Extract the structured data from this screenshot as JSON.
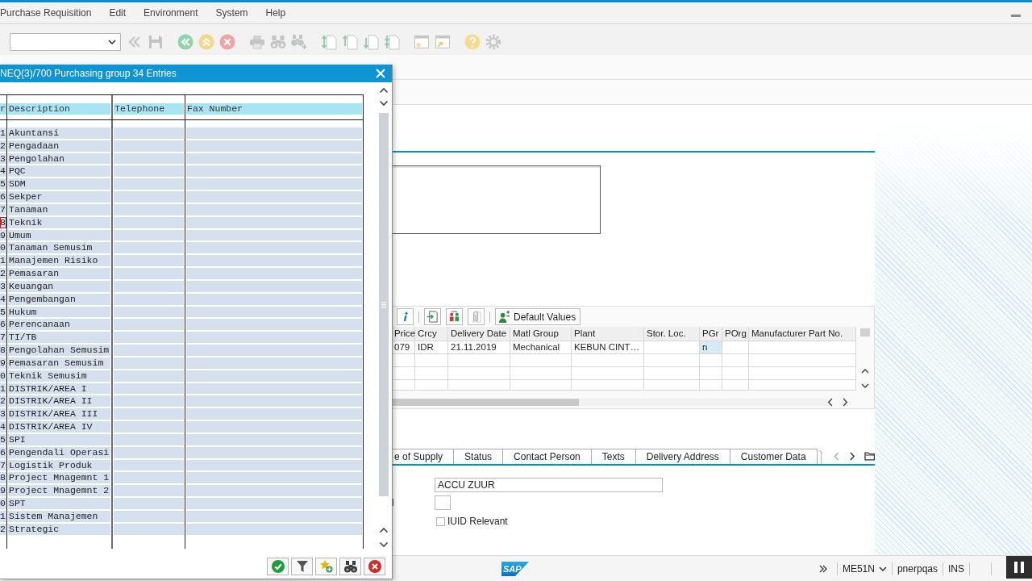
{
  "menu_bar": {
    "items": [
      {
        "label": "Purchase Requisition"
      },
      {
        "label": "Edit"
      },
      {
        "label": "Environment"
      },
      {
        "label": "System"
      },
      {
        "label": "Help"
      }
    ]
  },
  "item_toolbar": {
    "buttons": [
      {
        "label": "Default Values"
      }
    ]
  },
  "items_table": {
    "columns": [
      "Price",
      "Crcy",
      "Delivery Date",
      "Matl Group",
      "Plant",
      "Stor. Loc.",
      "PGr",
      "POrg",
      "Manufacturer Part No."
    ],
    "rows": [
      {
        "cells": [
          {
            "text": "079",
            "selected": false
          },
          {
            "text": "IDR",
            "selected": false
          },
          {
            "text": "21.11.2019",
            "selected": false
          },
          {
            "text": "Mechanical",
            "selected": false
          },
          {
            "text": "KEBUN CINT…",
            "selected": false
          },
          {
            "selected": false
          },
          {
            "text": "n",
            "selected": true
          },
          {
            "selected": false
          },
          {
            "selected": false
          }
        ]
      }
    ]
  },
  "detail_tabs": [
    {
      "label": "e of Supply",
      "selected": false
    },
    {
      "label": "Status",
      "selected": false
    },
    {
      "label": "Contact Person",
      "selected": false
    },
    {
      "label": "Texts",
      "selected": false
    },
    {
      "label": "Delivery Address",
      "selected": false
    },
    {
      "label": "Customer Data",
      "selected": false
    }
  ],
  "detail_fields": [
    {
      "kind": "text",
      "value": "ACCU ZUUR"
    },
    {
      "kind": "flag",
      "label": "l"
    },
    {
      "kind": "checkbox",
      "label": "IUID Relevant",
      "checked": false
    }
  ],
  "status_bar": {
    "logo": "SAP",
    "transaction": "ME51N",
    "system": "pnerpqas",
    "mode": "INS"
  },
  "popup": {
    "title": "NEQ(3)/700 Purchasing group 34 Entries",
    "columns": [
      "r",
      "Description",
      "Telephone",
      "Fax Number"
    ],
    "rows": [
      {
        "code": "1",
        "description": "Akuntansi",
        "focused": false
      },
      {
        "code": "2",
        "description": "Pengadaan",
        "focused": false
      },
      {
        "code": "3",
        "description": "Pengolahan",
        "focused": false
      },
      {
        "code": "4",
        "description": "PQC",
        "focused": false
      },
      {
        "code": "5",
        "description": "SDM",
        "focused": false
      },
      {
        "code": "6",
        "description": "Sekper",
        "focused": false
      },
      {
        "code": "7",
        "description": "Tanaman",
        "focused": false
      },
      {
        "code": "8",
        "description": "Teknik",
        "focused": true
      },
      {
        "code": "9",
        "description": "Umum",
        "focused": false
      },
      {
        "code": "0",
        "description": "Tanaman Semusim",
        "focused": false
      },
      {
        "code": "1",
        "description": "Manajemen Risiko",
        "focused": false
      },
      {
        "code": "2",
        "description": "Pemasaran",
        "focused": false
      },
      {
        "code": "3",
        "description": "Keuangan",
        "focused": false
      },
      {
        "code": "4",
        "description": "Pengembangan",
        "focused": false
      },
      {
        "code": "5",
        "description": "Hukum",
        "focused": false
      },
      {
        "code": "6",
        "description": "Perencanaan",
        "focused": false
      },
      {
        "code": "7",
        "description": "TI/TB",
        "focused": false
      },
      {
        "code": "8",
        "description": "Pengolahan Semusim",
        "focused": false
      },
      {
        "code": "9",
        "description": "Pemasaran Semusim",
        "focused": false
      },
      {
        "code": "0",
        "description": "Teknik Semusim",
        "focused": false
      },
      {
        "code": "1",
        "description": "DISTRIK/AREA I",
        "focused": false
      },
      {
        "code": "2",
        "description": "DISTRIK/AREA II",
        "focused": false
      },
      {
        "code": "3",
        "description": "DISTRIK/AREA III",
        "focused": false
      },
      {
        "code": "4",
        "description": "DISTRIK/AREA IV",
        "focused": false
      },
      {
        "code": "5",
        "description": "SPI",
        "focused": false
      },
      {
        "code": "6",
        "description": "Pengendali Operasi",
        "focused": false
      },
      {
        "code": "7",
        "description": "Logistik Produk",
        "focused": false
      },
      {
        "code": "8",
        "description": "Project Mnagemnt 1",
        "focused": false
      },
      {
        "code": "9",
        "description": "Project Mnagemnt 2",
        "focused": false
      },
      {
        "code": "0",
        "description": "SPT",
        "focused": false
      },
      {
        "code": "1",
        "description": "Sistem Manajemen",
        "focused": false
      },
      {
        "code": "2",
        "description": "Strategic",
        "focused": false
      }
    ]
  }
}
